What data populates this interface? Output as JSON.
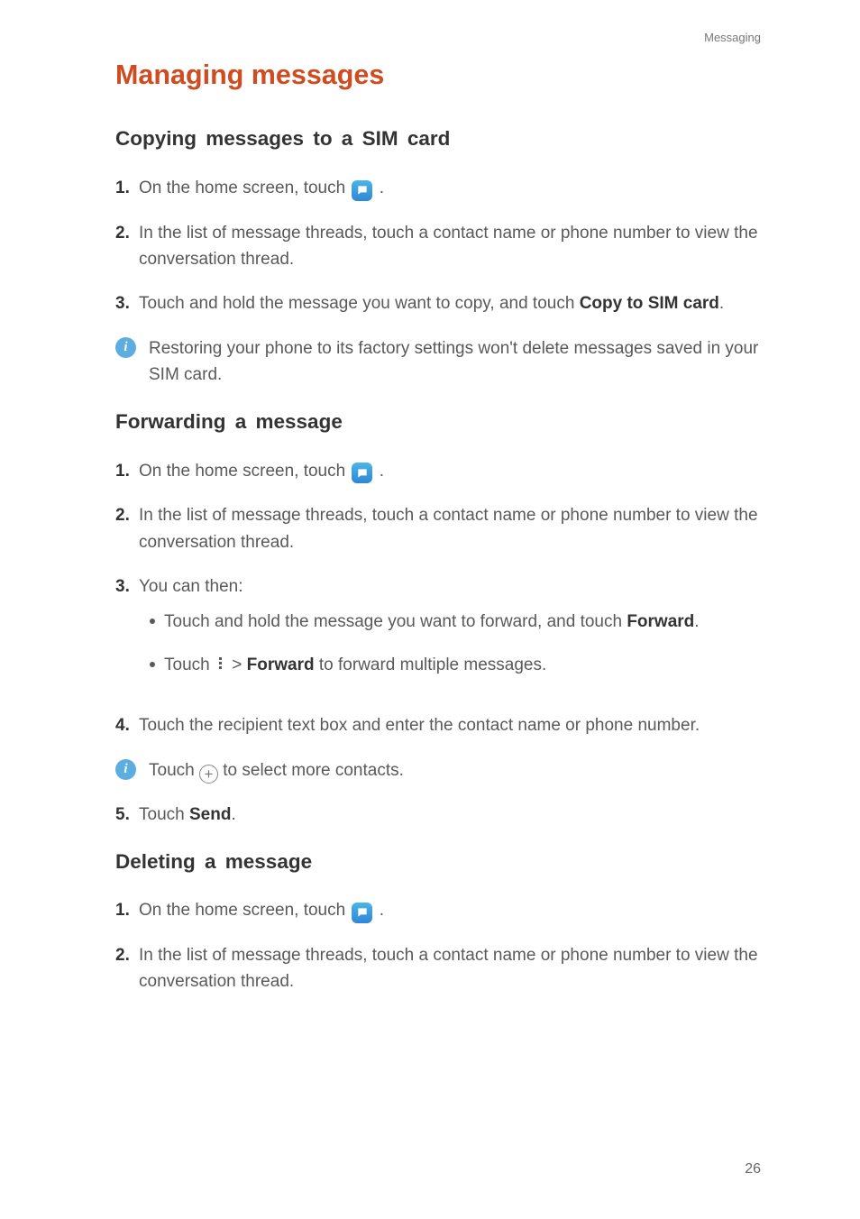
{
  "header": {
    "section_label": "Messaging"
  },
  "title": "Managing messages",
  "sections": {
    "copy": {
      "heading": "Copying messages to a SIM card",
      "step1_a": "On the home screen, touch ",
      "step1_b": ".",
      "step2": "In the list of message threads, touch a contact name or phone number to view the conversation thread.",
      "step3_a": "Touch and hold the message you want to copy, and touch ",
      "step3_bold": "Copy to SIM card",
      "step3_b": ".",
      "note": "Restoring your phone to its factory settings won't delete messages saved in your SIM card."
    },
    "forward": {
      "heading": "Forwarding a message",
      "step1_a": "On the home screen, touch ",
      "step1_b": ".",
      "step2": "In the list of message threads, touch a contact name or phone number to view the conversation thread.",
      "step3_intro": "You can then:",
      "bullet1_a": "Touch and hold the message you want to forward, and touch ",
      "bullet1_bold": "Forward",
      "bullet1_b": ".",
      "bullet2_a": "Touch ",
      "bullet2_b": " > ",
      "bullet2_bold": "Forward",
      "bullet2_c": " to forward multiple messages.",
      "step4": "Touch the recipient text box and enter the contact name or phone number.",
      "note_a": "Touch ",
      "note_b": " to select more contacts.",
      "step5_a": "Touch ",
      "step5_bold": "Send",
      "step5_b": "."
    },
    "delete": {
      "heading": "Deleting a message",
      "step1_a": "On the home screen, touch ",
      "step1_b": ".",
      "step2": "In the list of message threads, touch a contact name or phone number to view the conversation thread."
    }
  },
  "nums": {
    "n1": "1.",
    "n2": "2.",
    "n3": "3.",
    "n4": "4.",
    "n5": "5."
  },
  "page_number": "26"
}
